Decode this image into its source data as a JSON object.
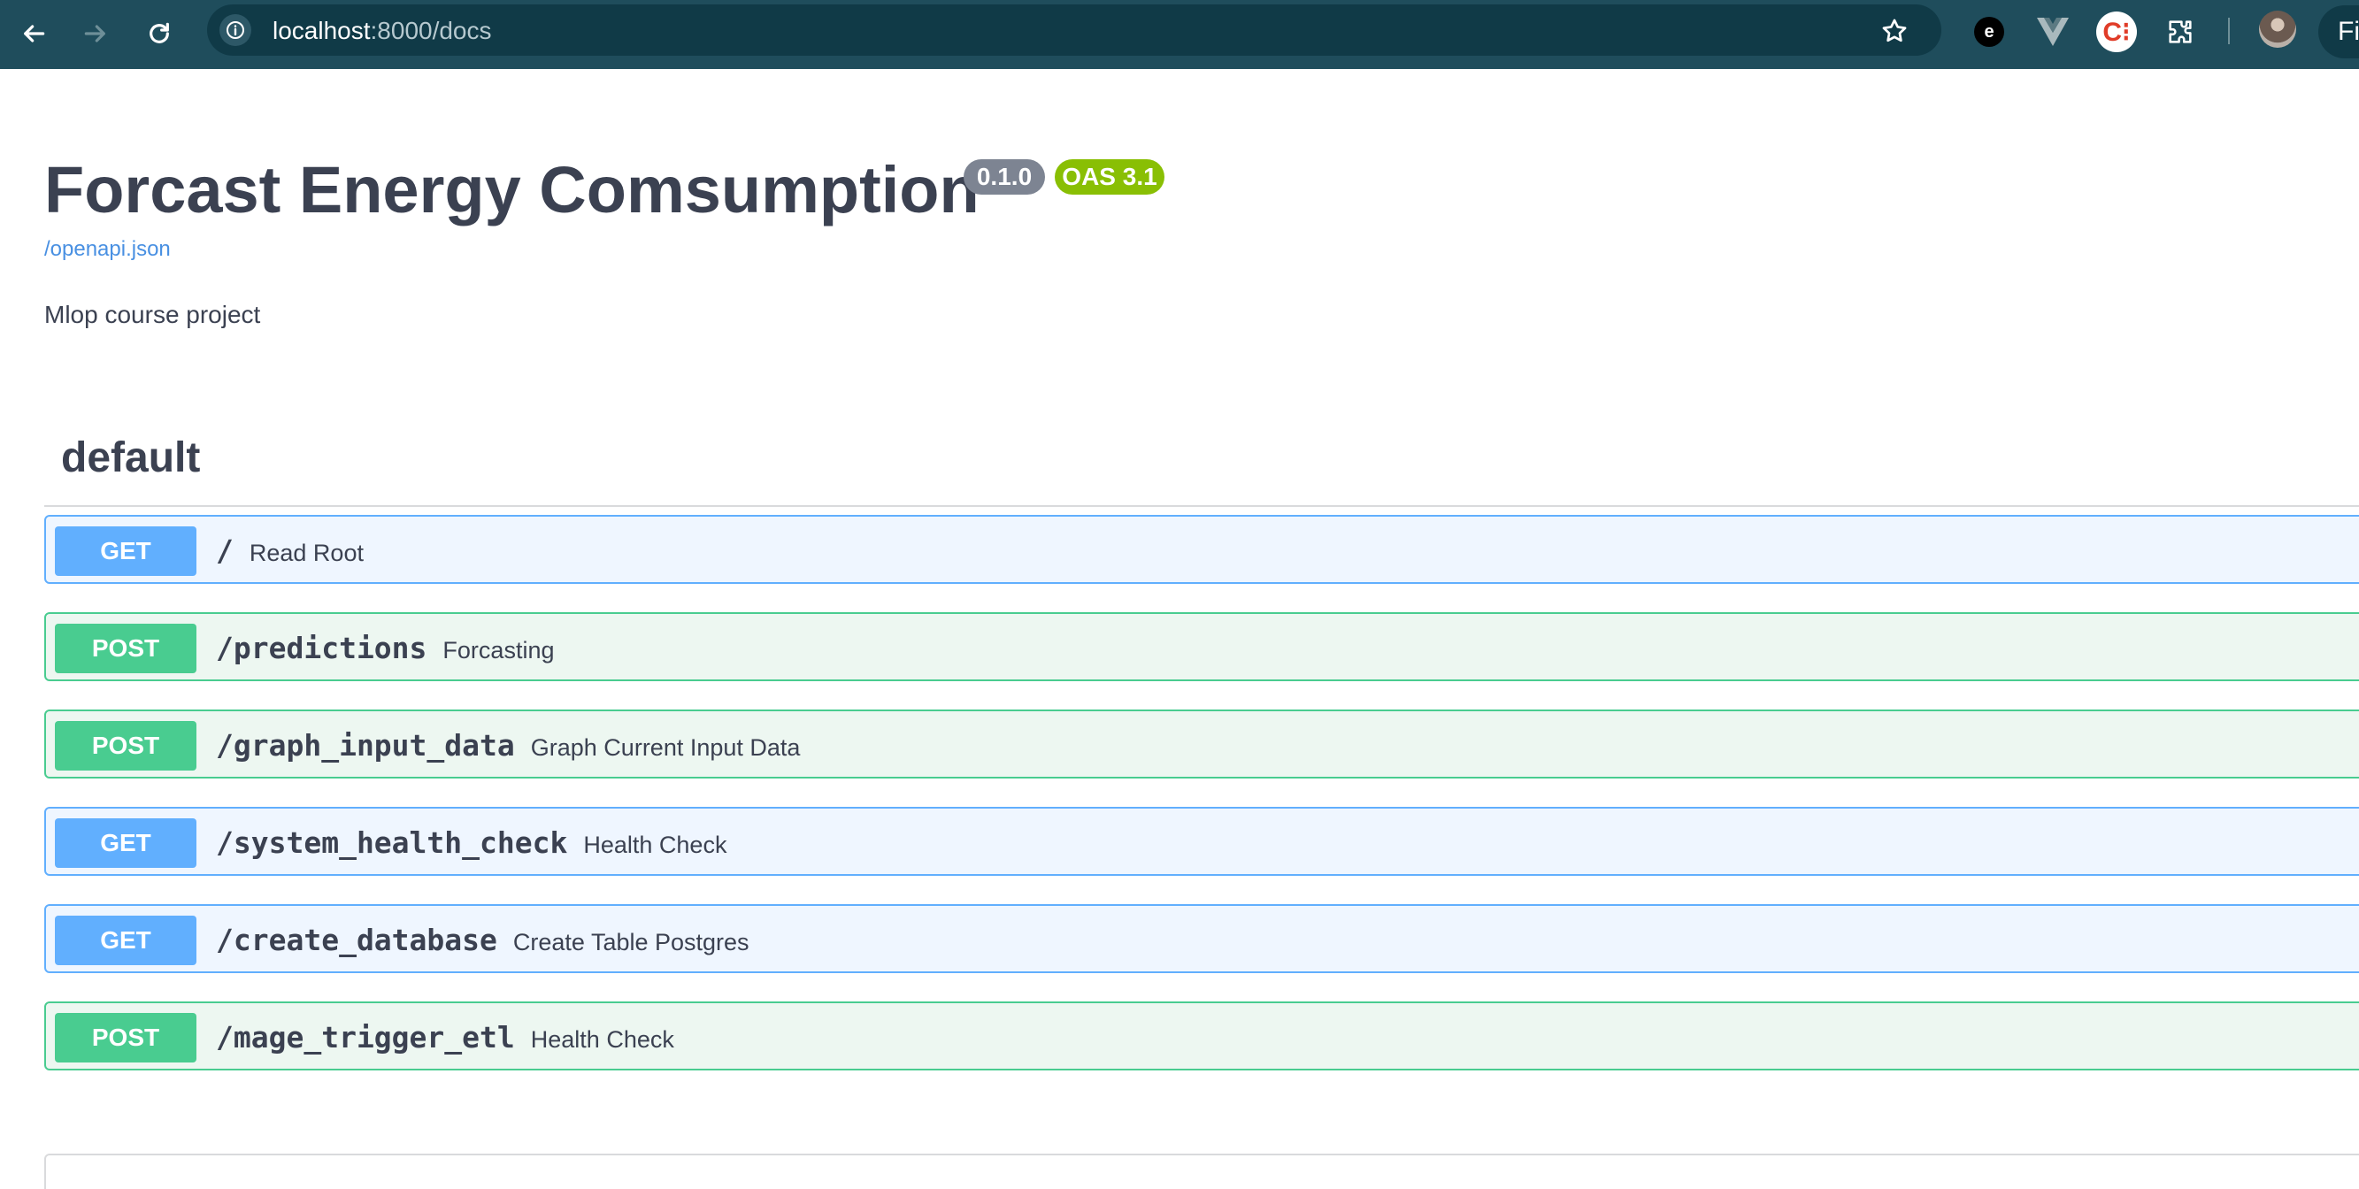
{
  "browser": {
    "url_host": "localhost",
    "url_rest": ":8000/docs",
    "profile_label": "Fi",
    "extension_c_label": "C⁝",
    "extension_e_label": "e"
  },
  "api": {
    "title": "Forcast Energy Comsumption",
    "version": "0.1.0",
    "oas": "OAS 3.1",
    "spec_link": "/openapi.json",
    "description": "Mlop course project"
  },
  "section": {
    "tag": "default"
  },
  "operations": [
    {
      "method": "GET",
      "path": "/",
      "summary": "Read Root"
    },
    {
      "method": "POST",
      "path": "/predictions",
      "summary": "Forcasting"
    },
    {
      "method": "POST",
      "path": "/graph_input_data",
      "summary": "Graph Current Input Data"
    },
    {
      "method": "GET",
      "path": "/system_health_check",
      "summary": "Health Check"
    },
    {
      "method": "GET",
      "path": "/create_database",
      "summary": "Create Table Postgres"
    },
    {
      "method": "POST",
      "path": "/mage_trigger_etl",
      "summary": "Health Check"
    }
  ],
  "colors": {
    "get": "#61affe",
    "post": "#49cc90",
    "version_badge": "#7d8492",
    "oas_badge": "#89bf04",
    "chrome": "#1f4d5c"
  }
}
